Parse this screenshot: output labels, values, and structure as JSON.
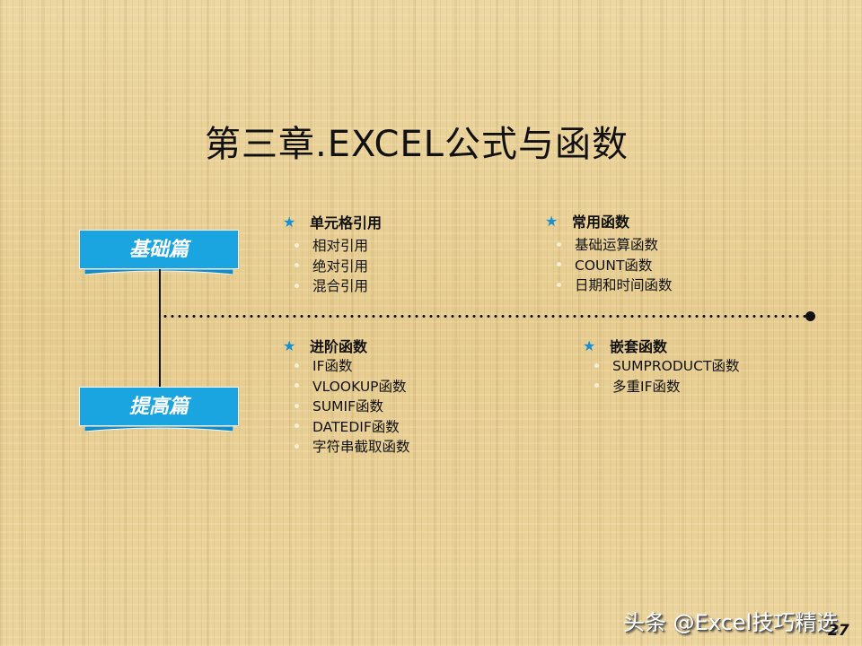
{
  "slide": {
    "title": "第三章.EXCEL公式与函数",
    "page_number": "27",
    "watermark": "头条 @Excel技巧精选",
    "accent_color": "#1aa4e0"
  },
  "banners": {
    "basic": "基础篇",
    "advanced": "提高篇"
  },
  "groups": {
    "cell_reference": {
      "heading": "单元格引用",
      "items": [
        "相对引用",
        "绝对引用",
        "混合引用"
      ]
    },
    "common_functions": {
      "heading": "常用函数",
      "items": [
        "基础运算函数",
        "COUNT函数",
        "日期和时间函数"
      ]
    },
    "advanced_functions": {
      "heading": "进阶函数",
      "items": [
        "IF函数",
        "VLOOKUP函数",
        "SUMIF函数",
        "DATEDIF函数",
        "字符串截取函数"
      ]
    },
    "nested_functions": {
      "heading": "嵌套函数",
      "items": [
        "SUMPRODUCT函数",
        "多重IF函数"
      ]
    }
  },
  "icons": {
    "star": "★"
  }
}
